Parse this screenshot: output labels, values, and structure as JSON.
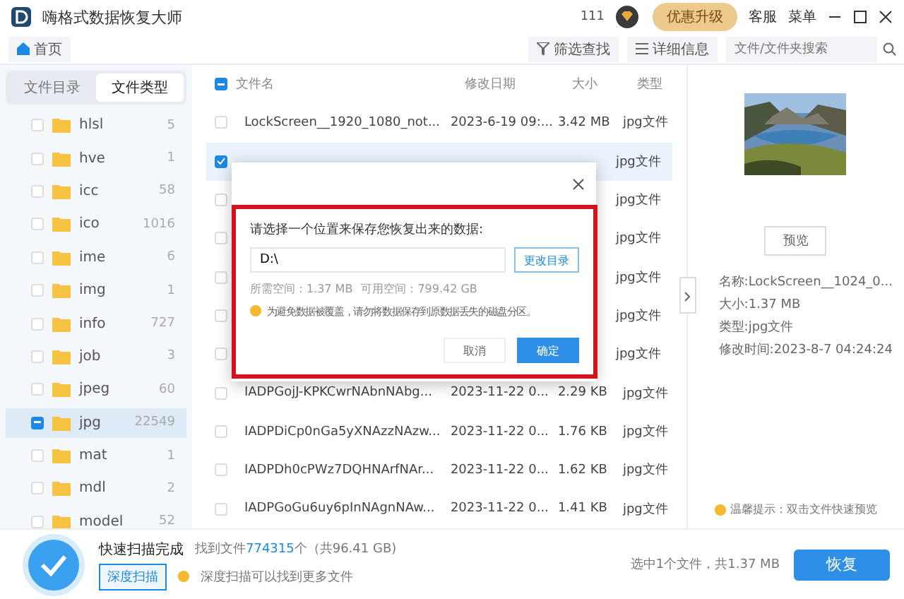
{
  "window": {
    "title": "嗨格式数据恢复大师",
    "count": "111",
    "upgrade": "优惠升级",
    "links": [
      "客服",
      "菜单"
    ]
  },
  "toolbar": {
    "home": "首页",
    "filter": "筛选查找",
    "details": "详细信息",
    "search": {
      "placeholder": "文件/文件夹搜索"
    }
  },
  "sidebar": {
    "tabs": [
      {
        "label": "文件目录",
        "selected": false
      },
      {
        "label": "文件类型",
        "selected": true
      }
    ],
    "items": [
      {
        "name": "hlsl",
        "count": "5",
        "checked": false,
        "selected": false
      },
      {
        "name": "hve",
        "count": "1",
        "checked": false,
        "selected": false
      },
      {
        "name": "icc",
        "count": "58",
        "checked": false,
        "selected": false
      },
      {
        "name": "ico",
        "count": "1016",
        "checked": false,
        "selected": false
      },
      {
        "name": "ime",
        "count": "6",
        "checked": false,
        "selected": false
      },
      {
        "name": "img",
        "count": "1",
        "checked": false,
        "selected": false
      },
      {
        "name": "info",
        "count": "727",
        "checked": false,
        "selected": false
      },
      {
        "name": "job",
        "count": "3",
        "checked": false,
        "selected": false
      },
      {
        "name": "jpeg",
        "count": "60",
        "checked": false,
        "selected": false
      },
      {
        "name": "jpg",
        "count": "22549",
        "checked": true,
        "selected": true
      },
      {
        "name": "mat",
        "count": "1",
        "checked": false,
        "selected": false
      },
      {
        "name": "mdl",
        "count": "2",
        "checked": false,
        "selected": false
      },
      {
        "name": "model",
        "count": "52",
        "checked": false,
        "selected": false
      }
    ]
  },
  "table": {
    "select_all": {
      "checked": true
    },
    "columns": [
      "文件名",
      "修改日期",
      "大小",
      "类型"
    ],
    "rows": [
      {
        "name": "LockScreen__1920_1080_not...",
        "date": "2023-6-19 09:...",
        "size": "3.42 MB",
        "type": "jpg文件",
        "checked": false,
        "selected": false
      },
      {
        "type": "jpg文件",
        "checked": true,
        "selected": true
      },
      {
        "type": "jpg文件",
        "checked": false,
        "selected": false
      },
      {
        "type": "jpg文件",
        "checked": false,
        "selected": false
      },
      {
        "type": "jpg文件",
        "checked": false,
        "selected": false
      },
      {
        "type": "jpg文件",
        "checked": false,
        "selected": false
      },
      {
        "type": "jpg文件",
        "checked": false,
        "selected": false
      },
      {
        "name": "IADPGojJ-KPKCwrNAbnNAbg...",
        "date": "2023-11-22 0...",
        "size": "2.29 KB",
        "type": "jpg文件",
        "checked": false,
        "selected": false
      },
      {
        "name": "IADPDiCp0nGa5yXNAzzNAzw...",
        "date": "2023-11-22 0...",
        "size": "1.76 KB",
        "type": "jpg文件",
        "checked": false,
        "selected": false
      },
      {
        "name": "IADPDh0cPWz7DQHNArfNAr...",
        "date": "2023-11-22 0...",
        "size": "1.62 KB",
        "type": "jpg文件",
        "checked": false,
        "selected": false
      },
      {
        "name": "IADPGoGu6uy6pInNAgnNAw...",
        "date": "2023-11-22 0...",
        "size": "1.41 KB",
        "type": "jpg文件",
        "checked": false,
        "selected": false
      }
    ]
  },
  "preview": {
    "kind": "picture",
    "button": "预览",
    "info": [
      "名称:LockScreen__1024_0...",
      "大小:1.37 MB",
      "类型:jpg文件",
      "修改时间:2023-8-7 04:24:24"
    ],
    "tip": "温馨提示：双击文件快速预览"
  },
  "dialog": {
    "prompt": "请选择一个位置来保存您恢复出来的数据:",
    "path": "D:\\",
    "change": "更改目录",
    "required": "所需空间：1.37 MB",
    "available": "可用空间：799.42 GB",
    "warning": "为避免数据被覆盖，请勿将数据保存到原数据丢失的磁盘分区。",
    "cancel": "取消",
    "ok": "确定"
  },
  "footer": {
    "status": "快速扫描完成",
    "found": "找到文件**774315**个（共96.41 GB)",
    "deep": "深度扫描",
    "hint": "深度扫描可以找到更多文件",
    "selection": "选中1个文件，共1.37 MB",
    "recover": "恢复"
  }
}
